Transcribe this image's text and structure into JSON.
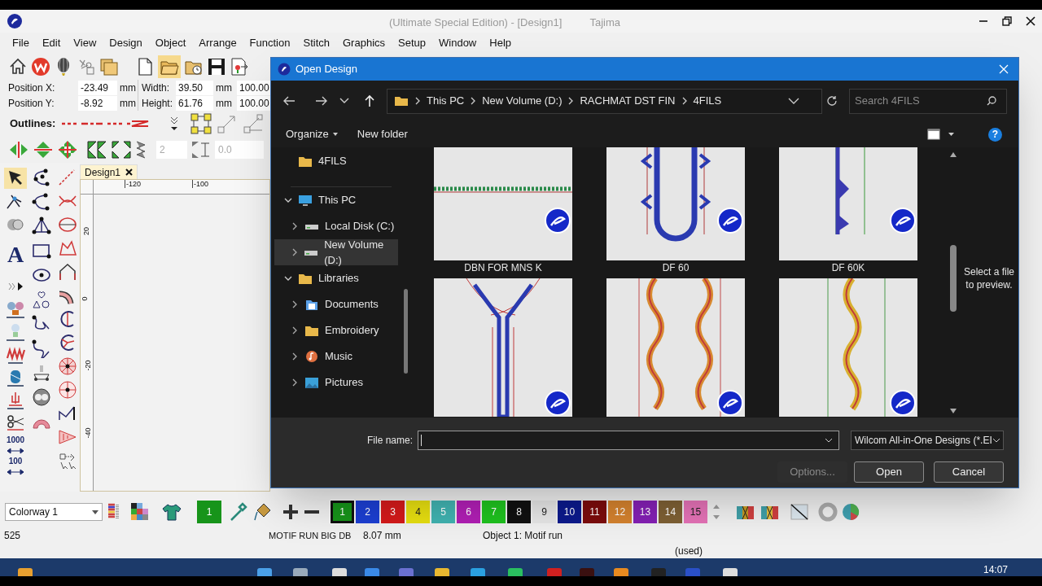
{
  "window": {
    "title": "(Ultimate Special Edition) - [Design1]",
    "subtitle": "Tajima"
  },
  "menu": [
    "File",
    "Edit",
    "View",
    "Design",
    "Object",
    "Arrange",
    "Function",
    "Stitch",
    "Graphics",
    "Setup",
    "Window",
    "Help"
  ],
  "position": [
    {
      "label": "Position X:",
      "value": "-23.49",
      "unit": "mm"
    },
    {
      "label": "Position Y:",
      "value": "-8.92",
      "unit": "mm"
    }
  ],
  "size": [
    {
      "label": "Width:",
      "value": "39.50",
      "unit": "mm",
      "scale": "100.00"
    },
    {
      "label": "Height:",
      "value": "61.76",
      "unit": "mm",
      "scale": "100.00"
    }
  ],
  "outlines_label": "Outlines:",
  "spinners": [
    "2",
    "0.0"
  ],
  "document_tab": "Design1",
  "rulers": {
    "horizontal": [
      "-120",
      "-100"
    ],
    "vertical": [
      "20",
      "0",
      "-20",
      "-40"
    ]
  },
  "toolbox": {
    "text_glyph": "A",
    "steps": [
      "1000",
      "100"
    ]
  },
  "colorway": "Colorway 1",
  "current_color": {
    "label": "1",
    "color": "#17941a"
  },
  "palette": [
    {
      "label": "1",
      "color": "#17941a",
      "selected": true
    },
    {
      "label": "2",
      "color": "#1c3fd2",
      "selected": false
    },
    {
      "label": "3",
      "color": "#d41a1a",
      "selected": false
    },
    {
      "label": "4",
      "color": "#e6de10",
      "selected": false
    },
    {
      "label": "5",
      "color": "#40b2b0",
      "selected": false
    },
    {
      "label": "6",
      "color": "#b01fb4",
      "selected": false
    },
    {
      "label": "7",
      "color": "#1fc21f",
      "selected": false
    },
    {
      "label": "8",
      "color": "#101010",
      "selected": false
    },
    {
      "label": "9",
      "color": "#e6e6e6",
      "selected": false
    },
    {
      "label": "10",
      "color": "#0c1a8c",
      "selected": false
    },
    {
      "label": "11",
      "color": "#7c0c0c",
      "selected": false
    },
    {
      "label": "12",
      "color": "#d4822e",
      "selected": false
    },
    {
      "label": "13",
      "color": "#8420b4",
      "selected": false
    },
    {
      "label": "14",
      "color": "#7e6034",
      "selected": false
    },
    {
      "label": "15",
      "color": "#e472b6",
      "selected": false
    }
  ],
  "status_bar": {
    "count": "525",
    "object_name": "MOTIF RUN BIG DB",
    "length": "8.07 mm",
    "selection": "Object 1: Motif run",
    "note": "(used)"
  },
  "taskbar": {
    "clock": "14:07"
  },
  "dialog": {
    "title": "Open Design",
    "breadcrumb": [
      "This PC",
      "New Volume (D:)",
      "RACHMAT DST FIN",
      "4FILS"
    ],
    "search_placeholder": "Search 4FILS",
    "toolbar": [
      "Organize",
      "New folder"
    ],
    "help": "?",
    "nav": [
      {
        "label": "4FILS",
        "kind": "folder",
        "selected": false
      },
      {
        "label": "This PC",
        "kind": "pc",
        "expanded": true,
        "selected": false,
        "children": [
          {
            "label": "Local Disk (C:)",
            "kind": "drive",
            "expanded": false,
            "selected": false
          },
          {
            "label": "New Volume (D:)",
            "kind": "drive",
            "expanded": false,
            "selected": true
          }
        ]
      },
      {
        "label": "Libraries",
        "kind": "folder",
        "expanded": true,
        "selected": false,
        "children": [
          {
            "label": "Documents",
            "kind": "documents",
            "expanded": false,
            "selected": false
          },
          {
            "label": "Embroidery",
            "kind": "folder",
            "expanded": false,
            "selected": false
          },
          {
            "label": "Music",
            "kind": "music",
            "expanded": false,
            "selected": false
          },
          {
            "label": "Pictures",
            "kind": "pictures",
            "expanded": false,
            "selected": false
          }
        ]
      }
    ],
    "files": [
      {
        "kind": "picture",
        "name": "DBN FOR MNS K"
      },
      {
        "kind": "picture",
        "name": "DF 60"
      },
      {
        "kind": "picture",
        "name": "DF 60K"
      },
      {
        "kind": "picture"
      },
      {
        "kind": "picture"
      },
      {
        "kind": "picture"
      }
    ],
    "preview_hint": "Select a file to preview.",
    "file_name_label": "File name:",
    "file_types": "Wilcom All-in-One Designs (*.EI",
    "buttons": [
      {
        "label": "Options...",
        "disabled": true
      },
      {
        "label": "Open",
        "disabled": false
      },
      {
        "label": "Cancel",
        "disabled": false
      }
    ]
  }
}
